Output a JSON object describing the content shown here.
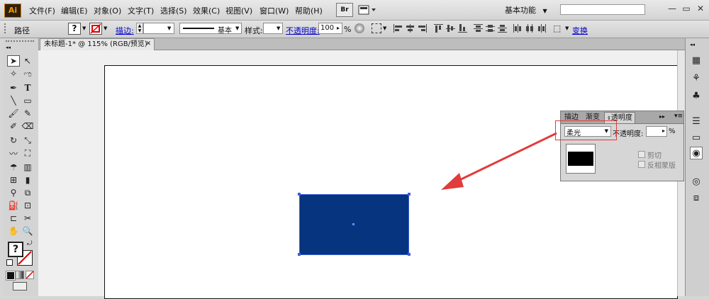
{
  "app": {
    "logo": "Ai"
  },
  "menu": [
    "文件(F)",
    "编辑(E)",
    "对象(O)",
    "文字(T)",
    "选择(S)",
    "效果(C)",
    "视图(V)",
    "窗口(W)",
    "帮助(H)"
  ],
  "menubar_buttons": {
    "bridge": "Br",
    "workspace": "基本功能"
  },
  "window_controls": {
    "minimize": "—",
    "restore": "▭",
    "close": "✕"
  },
  "control_bar": {
    "label": "路径",
    "fill_value": "?",
    "stroke_label": "描边:",
    "stroke_value": "",
    "brush_label": "基本",
    "style_label": "样式:",
    "opacity_label": "不透明度:",
    "opacity_value": "100",
    "opacity_unit": "%",
    "transform_label": "变换"
  },
  "document_tab": {
    "title": "未标题-1* @ 115% (RGB/预览)",
    "close": "✕"
  },
  "toolbox": {
    "tools": [
      "selection-tool",
      "direct-selection-tool",
      "magic-wand-tool",
      "lasso-tool",
      "pen-tool",
      "type-tool",
      "line-tool",
      "rectangle-tool",
      "paintbrush-tool",
      "pencil-tool",
      "blob-brush-tool",
      "eraser-tool",
      "rotate-tool",
      "scale-tool",
      "warp-tool",
      "free-transform-tool",
      "symbol-sprayer-tool",
      "column-graph-tool",
      "mesh-tool",
      "gradient-tool",
      "eyedropper-tool",
      "blend-tool",
      "live-paint-bucket-tool",
      "live-paint-selection-tool",
      "artboard-tool",
      "slice-tool",
      "hand-tool",
      "zoom-tool"
    ],
    "fill_value": "?"
  },
  "transparency_panel": {
    "tabs": [
      "描边",
      "渐变",
      "透明度"
    ],
    "blend_mode": "柔光",
    "opacity_label": "不透明度:",
    "opacity_value": "",
    "opacity_unit": "%",
    "clip_label": "剪切",
    "invert_mask_label": "反相蒙版"
  },
  "colors": {
    "rectangle_fill": "#07347e",
    "annotation": "#e23b3b",
    "accent_link": "#0000cc"
  }
}
